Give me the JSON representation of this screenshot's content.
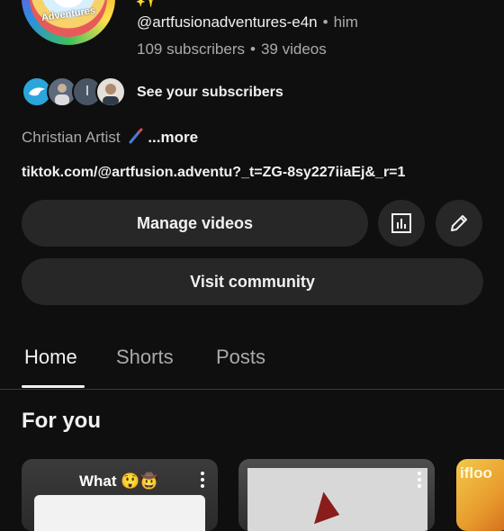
{
  "channel": {
    "avatar_text": "Adventures",
    "handle": "@artfusionadventures-e4n",
    "pronoun_separator": "•",
    "pronoun": "him",
    "subscribers": "109 subscribers",
    "stats_separator": "•",
    "videos": "39 videos",
    "see_subscribers_label": "See your subscribers",
    "subscriber_initial": "I",
    "bio_text": "Christian Artist",
    "bio_more": "...more",
    "link": "tiktok.com/@artfusion.adventu?_t=ZG-8sy227iiaEj&_r=1"
  },
  "actions": {
    "manage_videos_label": "Manage videos",
    "analytics_icon": "analytics-icon",
    "edit_icon": "pencil-icon",
    "visit_community_label": "Visit community"
  },
  "tabs": [
    {
      "label": "Home",
      "active": true
    },
    {
      "label": "Shorts",
      "active": false
    },
    {
      "label": "Posts",
      "active": false
    }
  ],
  "section": {
    "title": "For you"
  },
  "cards": [
    {
      "title": "What 😲🤠"
    },
    {
      "title": ""
    },
    {
      "title": "ifloo"
    }
  ],
  "colors": {
    "background": "#0f0f0f",
    "button_bg": "#272727",
    "text_primary": "#f1f1f1",
    "text_secondary": "#aaaaaa"
  }
}
